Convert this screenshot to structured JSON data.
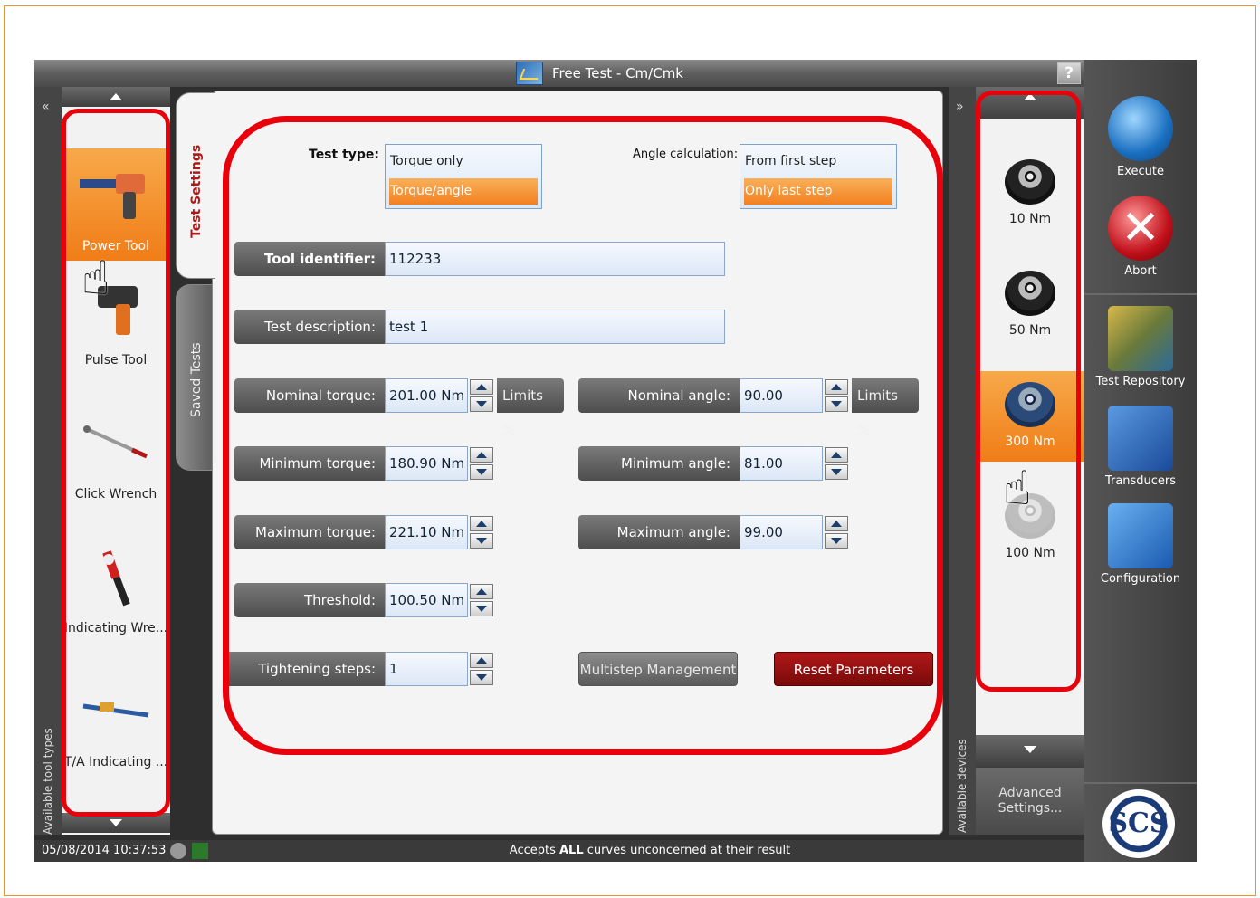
{
  "window": {
    "title": "Free Test - Cm/Cmk",
    "help_label": "?"
  },
  "left_panel": {
    "collapse_glyph": "«",
    "vertical_label": "Available tool types",
    "tools": [
      {
        "label": "Power Tool",
        "icon": "power-tool-icon",
        "selected": true
      },
      {
        "label": "Pulse Tool",
        "icon": "pulse-tool-icon",
        "selected": false
      },
      {
        "label": "Click Wrench",
        "icon": "click-wrench-icon",
        "selected": false
      },
      {
        "label": "Indicating Wre...",
        "icon": "indicating-wrench-icon",
        "selected": false
      },
      {
        "label": "T/A Indicating ...",
        "icon": "ta-indicating-icon",
        "selected": false
      }
    ]
  },
  "tabs": {
    "active": "Test Settings",
    "inactive": "Saved Tests"
  },
  "form": {
    "test_type": {
      "label": "Test type:",
      "options": [
        "Torque only",
        "Torque/angle"
      ],
      "selected": "Torque/angle"
    },
    "angle_calc": {
      "label": "Angle calculation:",
      "options": [
        "From first step",
        "Only last step"
      ],
      "selected": "Only last step"
    },
    "tool_identifier": {
      "label": "Tool identifier:",
      "value": "112233"
    },
    "test_description": {
      "label": "Test description:",
      "value": "test 1"
    },
    "nominal_torque": {
      "label": "Nominal torque:",
      "value": "201.00 Nm",
      "limits_label": "Limits %."
    },
    "minimum_torque": {
      "label": "Minimum torque:",
      "value": "180.90 Nm"
    },
    "maximum_torque": {
      "label": "Maximum torque:",
      "value": "221.10 Nm"
    },
    "threshold": {
      "label": "Threshold:",
      "value": "100.50 Nm"
    },
    "tightening_steps": {
      "label": "Tightening steps:",
      "value": "1"
    },
    "nominal_angle": {
      "label": "Nominal angle:",
      "value": "90.00",
      "limits_label": "Limits %."
    },
    "minimum_angle": {
      "label": "Minimum angle:",
      "value": "81.00"
    },
    "maximum_angle": {
      "label": "Maximum angle:",
      "value": "99.00"
    },
    "multistep_label": "Multistep Management",
    "reset_label": "Reset Parameters"
  },
  "devices_panel": {
    "expand_glyph": "»",
    "vertical_label": "Available devices",
    "devices": [
      {
        "label": "10 Nm",
        "selected": false
      },
      {
        "label": "50 Nm",
        "selected": false
      },
      {
        "label": "300 Nm",
        "selected": true
      },
      {
        "label": "100 Nm",
        "selected": false
      }
    ],
    "advanced_label": "Advanced Settings..."
  },
  "actions": [
    {
      "label": "Execute",
      "icon": "execute-icon"
    },
    {
      "label": "Abort",
      "icon": "abort-icon"
    },
    {
      "label": "Test Repository",
      "icon": "test-repository-icon"
    },
    {
      "label": "Transducers",
      "icon": "transducers-icon"
    },
    {
      "label": "Configuration",
      "icon": "configuration-icon"
    }
  ],
  "logo_text": "SCS",
  "status": {
    "datetime": "05/08/2014 10:37:53",
    "message_prefix": "Accepts ",
    "message_bold": "ALL",
    "message_suffix": " curves unconcerned at their result"
  },
  "colors": {
    "accent_orange": "#f28020",
    "annotation_red": "#e8000a",
    "reset_red": "#9a1010"
  }
}
